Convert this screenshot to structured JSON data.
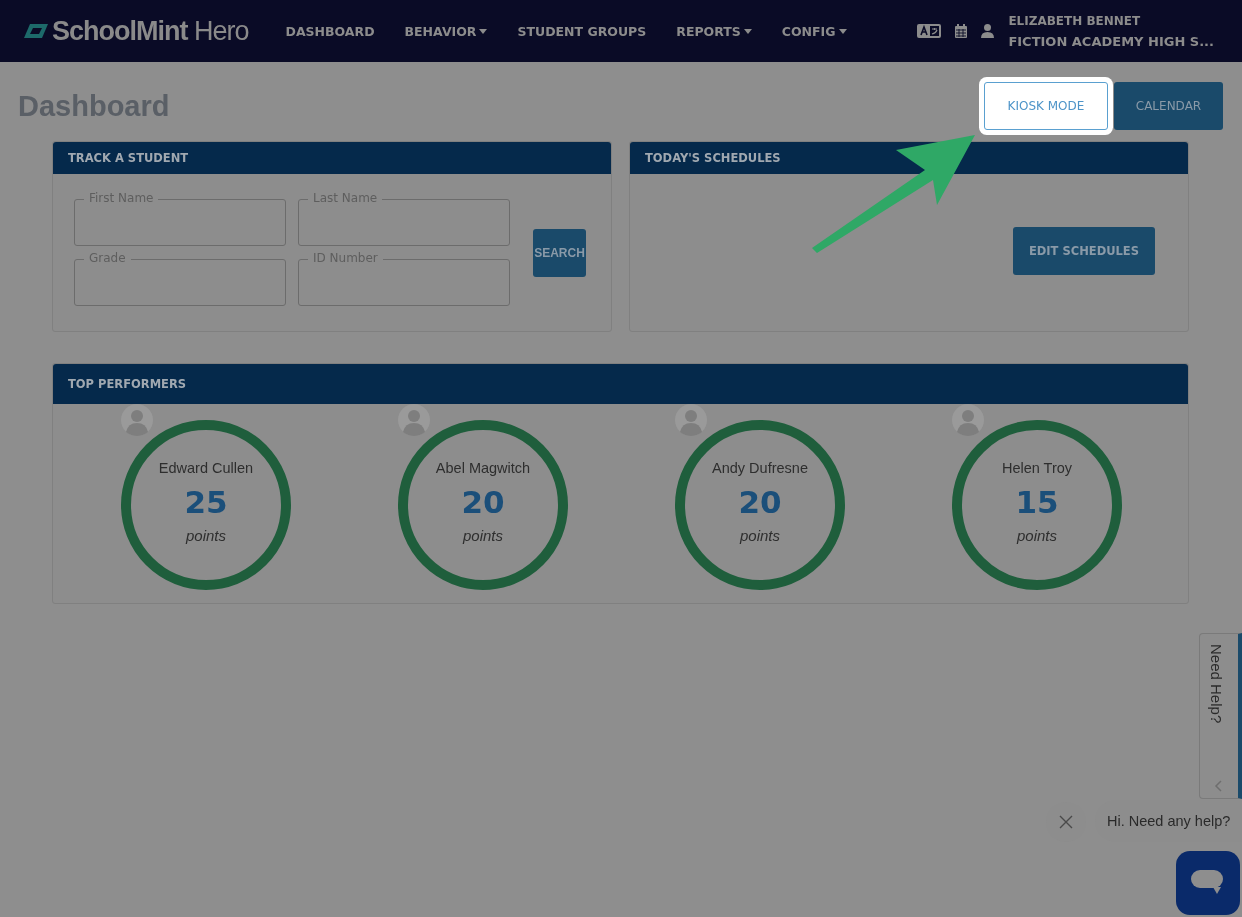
{
  "brand": {
    "name": "SchoolMint",
    "suffix": "Hero"
  },
  "nav": [
    {
      "label": "DASHBOARD",
      "dropdown": false
    },
    {
      "label": "BEHAVIOR",
      "dropdown": true
    },
    {
      "label": "STUDENT GROUPS",
      "dropdown": false
    },
    {
      "label": "REPORTS",
      "dropdown": true
    },
    {
      "label": "CONFIG",
      "dropdown": true
    }
  ],
  "user": {
    "name": "ELIZABETH BENNET",
    "school": "FICTION ACADEMY HIGH S..."
  },
  "page_title": "Dashboard",
  "actions": [
    {
      "label": "KIOSK MODE",
      "highlighted": true
    },
    {
      "label": "CALENDAR",
      "highlighted": false
    }
  ],
  "track_student": {
    "title": "TRACK A STUDENT",
    "fields": [
      {
        "label": "First Name"
      },
      {
        "label": "Last Name"
      },
      {
        "label": "Grade"
      },
      {
        "label": "ID Number"
      }
    ],
    "button": "SEARCH"
  },
  "schedules": {
    "title": "TODAY'S SCHEDULES",
    "button": "EDIT SCHEDULES"
  },
  "top_performers": {
    "title": "TOP PERFORMERS",
    "items": [
      {
        "name": "Edward Cullen",
        "points": "25",
        "unit": "points"
      },
      {
        "name": "Abel Magwitch",
        "points": "20",
        "unit": "points"
      },
      {
        "name": "Andy Dufresne",
        "points": "20",
        "unit": "points"
      },
      {
        "name": "Helen Troy",
        "points": "15",
        "unit": "points"
      }
    ]
  },
  "help_tab": "Need Help?",
  "chat": {
    "message": "Hi. Need any help?"
  }
}
